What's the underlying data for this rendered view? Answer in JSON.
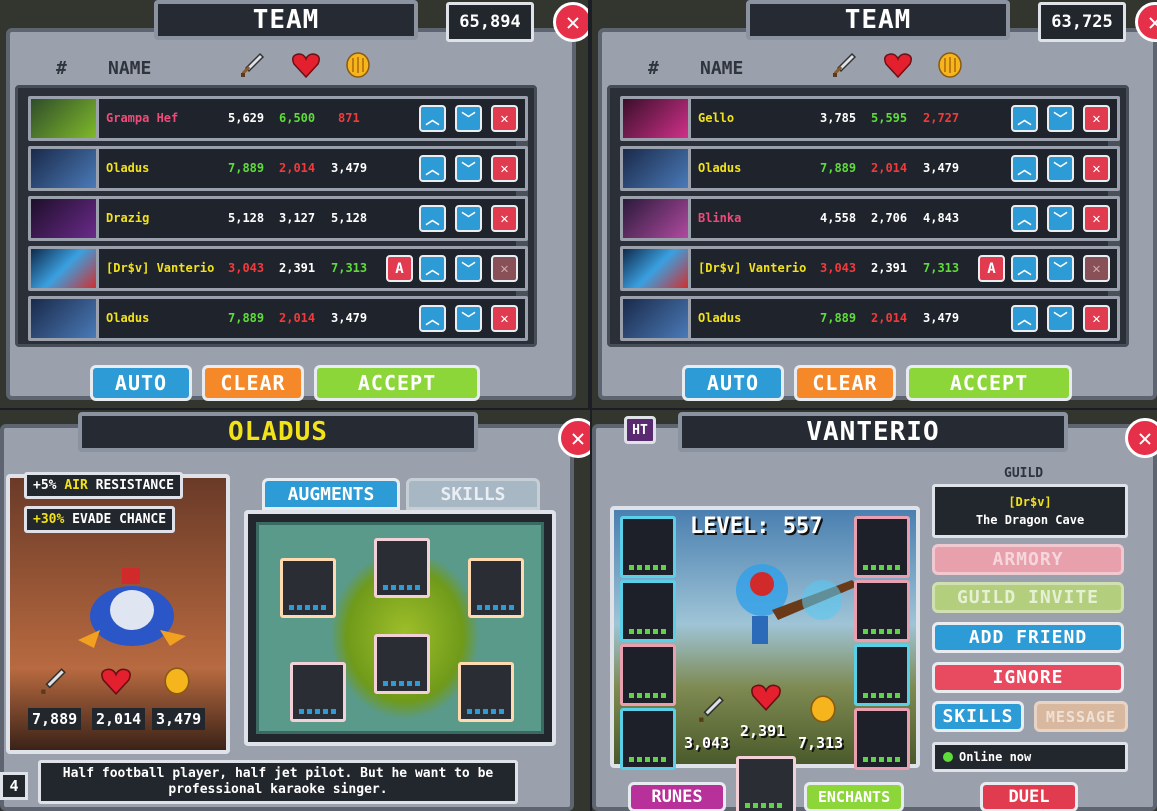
{
  "team_left": {
    "title": "TEAM",
    "score": "65,894",
    "header": {
      "num": "#",
      "name": "NAME"
    },
    "rows": [
      {
        "name": "Grampa Hef",
        "name_color": "#f04a7a",
        "atk": "5,629",
        "atk_color": "#ffffff",
        "hp": "6,500",
        "hp_color": "#5fdc3a",
        "gold": "871",
        "gold_color": "#f23a3a",
        "a": false
      },
      {
        "name": "Oladus",
        "name_color": "#f2e21a",
        "atk": "7,889",
        "atk_color": "#5fdc3a",
        "hp": "2,014",
        "hp_color": "#f23a3a",
        "gold": "3,479",
        "gold_color": "#ffffff",
        "a": false
      },
      {
        "name": "Drazig",
        "name_color": "#f2e21a",
        "atk": "5,128",
        "atk_color": "#ffffff",
        "hp": "3,127",
        "hp_color": "#ffffff",
        "gold": "5,128",
        "gold_color": "#ffffff",
        "a": false
      },
      {
        "name": "[Dr$v] Vanterio",
        "name_color": "#f2e21a",
        "atk": "3,043",
        "atk_color": "#f23a3a",
        "hp": "2,391",
        "hp_color": "#ffffff",
        "gold": "7,313",
        "gold_color": "#5fdc3a",
        "a": true
      },
      {
        "name": "Oladus",
        "name_color": "#f2e21a",
        "atk": "7,889",
        "atk_color": "#5fdc3a",
        "hp": "2,014",
        "hp_color": "#f23a3a",
        "gold": "3,479",
        "gold_color": "#ffffff",
        "a": false
      }
    ],
    "buttons": {
      "auto": "AUTO",
      "clear": "CLEAR",
      "accept": "ACCEPT"
    }
  },
  "team_right": {
    "title": "TEAM",
    "score": "63,725",
    "header": {
      "num": "#",
      "name": "NAME"
    },
    "rows": [
      {
        "name": "Gello",
        "name_color": "#f2e21a",
        "atk": "3,785",
        "atk_color": "#ffffff",
        "hp": "5,595",
        "hp_color": "#5fdc3a",
        "gold": "2,727",
        "gold_color": "#f23a3a",
        "a": false
      },
      {
        "name": "Oladus",
        "name_color": "#f2e21a",
        "atk": "7,889",
        "atk_color": "#5fdc3a",
        "hp": "2,014",
        "hp_color": "#f23a3a",
        "gold": "3,479",
        "gold_color": "#ffffff",
        "a": false
      },
      {
        "name": "Blinka",
        "name_color": "#f04a7a",
        "atk": "4,558",
        "atk_color": "#ffffff",
        "hp": "2,706",
        "hp_color": "#ffffff",
        "gold": "4,843",
        "gold_color": "#ffffff",
        "a": false
      },
      {
        "name": "[Dr$v] Vanterio",
        "name_color": "#f2e21a",
        "atk": "3,043",
        "atk_color": "#f23a3a",
        "hp": "2,391",
        "hp_color": "#ffffff",
        "gold": "7,313",
        "gold_color": "#5fdc3a",
        "a": true
      },
      {
        "name": "Oladus",
        "name_color": "#f2e21a",
        "atk": "7,889",
        "atk_color": "#5fdc3a",
        "hp": "2,014",
        "hp_color": "#f23a3a",
        "gold": "3,479",
        "gold_color": "#ffffff",
        "a": false
      }
    ],
    "buttons": {
      "auto": "AUTO",
      "clear": "CLEAR",
      "accept": "ACCEPT"
    }
  },
  "hero": {
    "title": "OLADUS",
    "bonus1_prefix": "+5%",
    "bonus1_accent": "AIR",
    "bonus1_rest": "RESISTANCE",
    "bonus2_prefix": "+30%",
    "bonus2_rest": "EVADE CHANCE",
    "atk": "7,889",
    "hp": "2,014",
    "gold": "3,479",
    "tab_augments": "AUGMENTS",
    "tab_skills": "SKILLS",
    "desc": "Half football player, half jet pilot. But he want to be professional karaoke singer.",
    "page": "4"
  },
  "profile": {
    "title": "VANTERIO",
    "tag": "HT",
    "guild_label": "GUILD",
    "guild_tag": "[Dr$v]",
    "guild_name": "The Dragon Cave",
    "level": "LEVEL: 557",
    "armory": "ARMORY",
    "guild_invite": "GUILD INVITE",
    "add_friend": "ADD FRIEND",
    "ignore": "IGNORE",
    "skills": "SKILLS",
    "message": "MESSAGE",
    "status": "Online now",
    "atk": "3,043",
    "hp": "2,391",
    "gold": "7,313",
    "runes": "RUNES",
    "enchants": "ENCHANTS",
    "duel": "DUEL"
  },
  "icons": [
    "sword-icon",
    "heart-icon",
    "coin-icon",
    "close-icon",
    "chevron-up-icon",
    "chevron-down-icon"
  ],
  "colors": {
    "blue": "#2c9bd6",
    "orange": "#f5892a",
    "green": "#8dd63a",
    "red": "#e03b4e",
    "yellow": "#f2e21a"
  }
}
